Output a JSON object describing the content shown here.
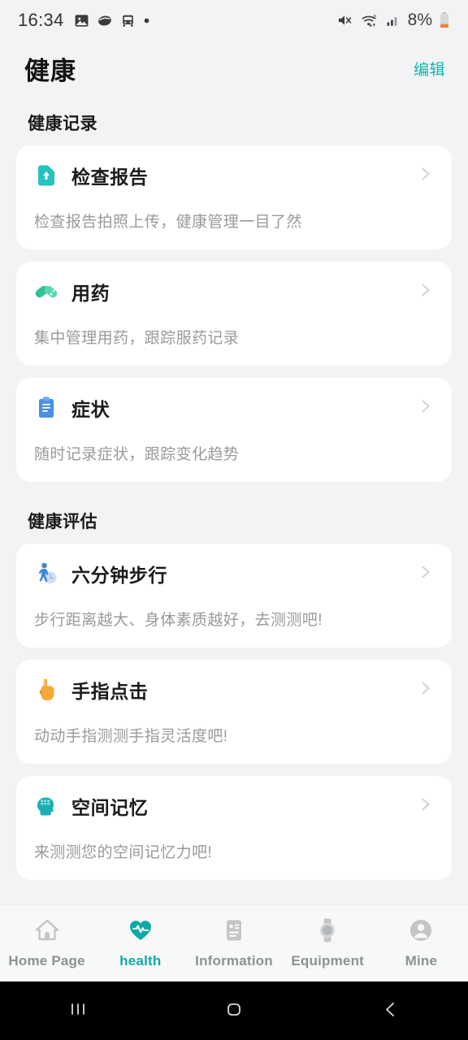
{
  "status_bar": {
    "time": "16:34",
    "left_icons": [
      "photo-icon",
      "capsule-icon",
      "transit-icon",
      "dot-icon"
    ],
    "right_icons": [
      "mute-icon",
      "wifi-icon",
      "signal-icon"
    ],
    "battery_percent": "8%"
  },
  "header": {
    "title": "健康",
    "edit_label": "编辑"
  },
  "colors": {
    "accent": "#16b3ab",
    "tab_active": "#0eaaa6",
    "page_bg": "#f2f3f5",
    "card_bg": "#ffffff",
    "title_text": "#1b1b1b",
    "desc_text": "#9a9a9e"
  },
  "sections": [
    {
      "title": "健康记录",
      "cards": [
        {
          "icon": "report-upload-icon",
          "title": "检查报告",
          "desc": "检查报告拍照上传，健康管理一目了然"
        },
        {
          "icon": "pills-icon",
          "title": "用药",
          "desc": "集中管理用药，跟踪服药记录"
        },
        {
          "icon": "clipboard-icon",
          "title": "症状",
          "desc": "随时记录症状，跟踪变化趋势"
        }
      ]
    },
    {
      "title": "健康评估",
      "cards": [
        {
          "icon": "walking-person-icon",
          "title": "六分钟步行",
          "desc": "步行距离越大、身体素质越好，去测测吧!"
        },
        {
          "icon": "finger-tap-icon",
          "title": "手指点击",
          "desc": "动动手指测测手指灵活度吧!"
        },
        {
          "icon": "brain-head-icon",
          "title": "空间记忆",
          "desc": "来测测您的空间记忆力吧!"
        }
      ]
    }
  ],
  "tabbar": {
    "tabs": [
      {
        "icon": "home-icon",
        "label": "Home Page",
        "active": false
      },
      {
        "icon": "heart-pulse-icon",
        "label": "health",
        "active": true
      },
      {
        "icon": "id-card-icon",
        "label": "Information",
        "active": false
      },
      {
        "icon": "watch-icon",
        "label": "Equipment",
        "active": false
      },
      {
        "icon": "person-icon",
        "label": "Mine",
        "active": false
      }
    ]
  },
  "system_nav": {
    "buttons": [
      "recents-icon",
      "home-icon",
      "back-icon"
    ]
  }
}
